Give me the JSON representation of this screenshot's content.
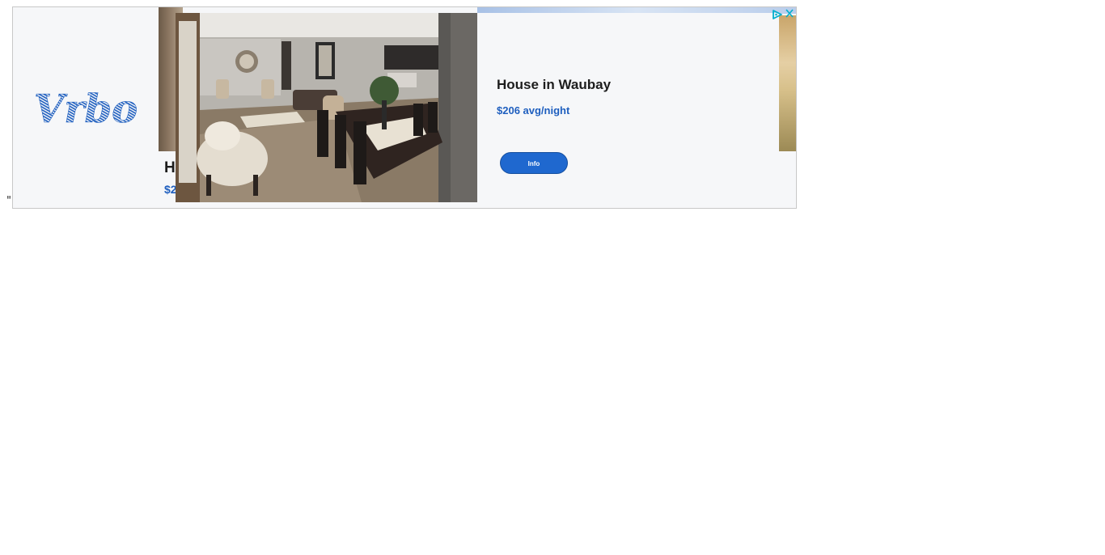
{
  "page": {
    "stray_text": "\""
  },
  "ad": {
    "brand": "Vrbo",
    "brand_color": "#1f5fbf",
    "close_icon": "close-icon",
    "adchoices_icon": "adchoices-icon",
    "partial_card": {
      "title": "H",
      "price": "$2"
    },
    "listing": {
      "title": "House in Waubay",
      "price": "$206 avg/night",
      "cta": "Info",
      "cta_color": "#1f68cf"
    }
  }
}
